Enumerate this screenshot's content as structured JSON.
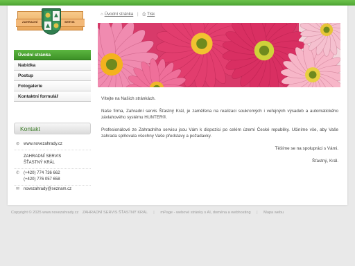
{
  "logo": {
    "left_text": "ZAHRADNÍ",
    "right_text": "SERVIS",
    "colors": {
      "ribbon": "#f3b979",
      "shield": "#2f7d4f"
    }
  },
  "toplinks": {
    "home_label": "Úvodní stránka",
    "print_label": "Tisk",
    "home_icon": "home-icon",
    "print_icon": "printer-icon"
  },
  "menu": {
    "items": [
      {
        "label": "Úvodní stránka",
        "active": true
      },
      {
        "label": "Nabídka",
        "active": false
      },
      {
        "label": "Postup",
        "active": false
      },
      {
        "label": "Fotogalerie",
        "active": false
      },
      {
        "label": "Kontaktní formulář",
        "active": false
      }
    ],
    "active_color": "#4fa635"
  },
  "contact": {
    "heading": "Kontakt",
    "website": "www.novezahrady.cz",
    "company_line1": "ZAHRADNÍ SERVIS",
    "company_line2": "ŠŤASTNÝ KRÁL",
    "phone1": "(+420) 774 736 662",
    "phone2": "(+420) 776 057 658",
    "email": "novezahrady@seznam.cz"
  },
  "content": {
    "p1": "Vítejte na Našich stránkách.",
    "p2": "Naše firma, Zahradní servis Šťastný Král, je zaměřena na realizaci soukromých i veřejných výsadeb a automatického závlahového systému HUNTER®.",
    "p3": "Profesionálové ze Zahradního servisu jsou Vám k dispozici po celém území České republiky. Učiníme vše, aby Vaše zahrada splňovala všechny Vaše představy a požadavky.",
    "p4": "Těšíme se na spolupráci s Vámi.",
    "p5": "Šťastný, Král."
  },
  "footer": {
    "copyright": "Copyright © 2025 www.novezahrady.cz",
    "company": "ZAHRADNÍ SERVIS ŠŤASTNÝ KRÁL",
    "webpage": "mPage - webové stránky s AI, doména a webhosting",
    "sitemap": "Mapa webu"
  },
  "theme": {
    "accent": "#4fa635",
    "topbar": "#6cc24a",
    "background": "#e9e9e9"
  }
}
